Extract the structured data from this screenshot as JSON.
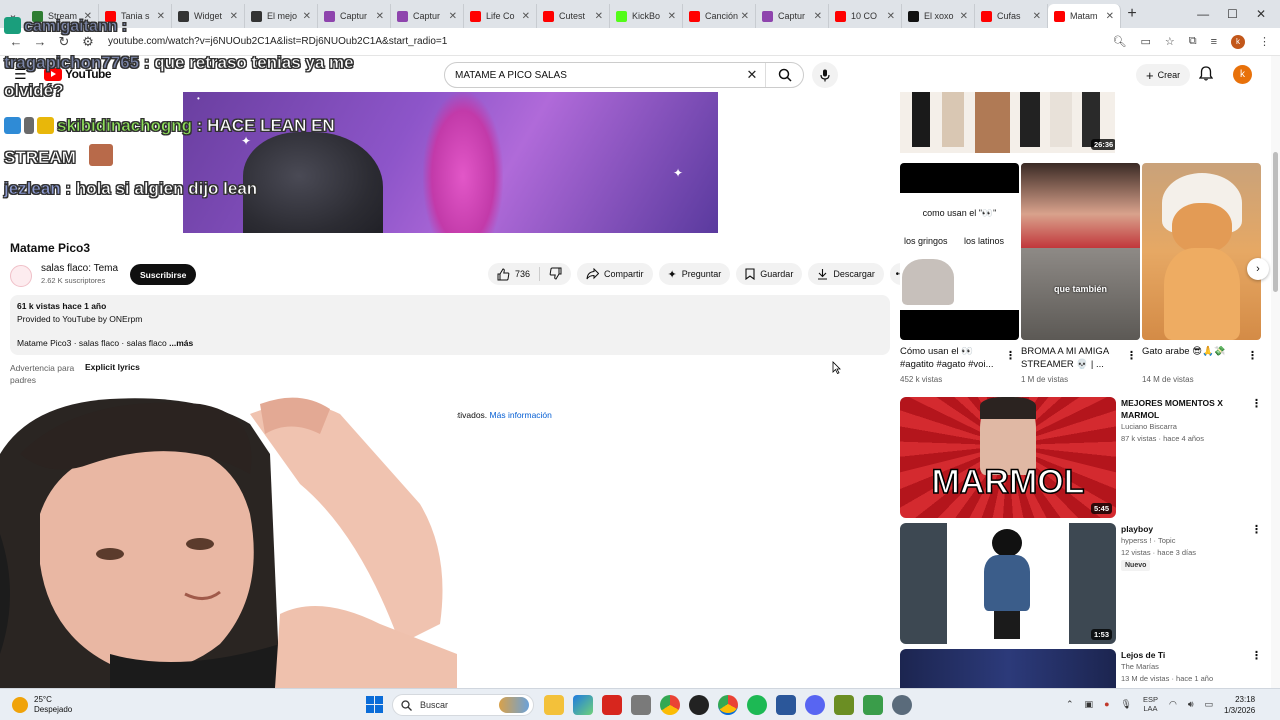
{
  "browser": {
    "tabs": [
      {
        "label": "Stream",
        "color": "#2e7d32"
      },
      {
        "label": "Tania s",
        "color": "#ff0000"
      },
      {
        "label": "Widget",
        "color": "#333333"
      },
      {
        "label": "El mejo",
        "color": "#333333"
      },
      {
        "label": "Captur",
        "color": "#8e44ad"
      },
      {
        "label": "Captur",
        "color": "#8e44ad"
      },
      {
        "label": "Life Co",
        "color": "#ff0000"
      },
      {
        "label": "Cutest",
        "color": "#ff0000"
      },
      {
        "label": "KickBo",
        "color": "#53fc18"
      },
      {
        "label": "Canción",
        "color": "#ff0000"
      },
      {
        "label": "Captur",
        "color": "#8e44ad"
      },
      {
        "label": "10 CO",
        "color": "#ff0000"
      },
      {
        "label": "El xoxo",
        "color": "#111111"
      },
      {
        "label": "Cufas",
        "color": "#ff0000"
      },
      {
        "label": "Matam",
        "color": "#ff0000"
      }
    ],
    "url": "youtube.com/watch?v=j6NUOub2C1A&list=RDj6NUOub2C1A&start_radio=1"
  },
  "youtube": {
    "logo_text": "YouTube",
    "search_value": "MATAME A PICO SALAS",
    "create_label": "Crear",
    "avatar_letter": "k"
  },
  "chat": [
    {
      "user": "tragapichon7765",
      "sep": " : ",
      "msg": "que retraso tenias ya me",
      "msg2": "olvidé?"
    },
    {
      "user": "skibidinachogng",
      "sep": " : ",
      "msg": "HACE LEAN EN",
      "msg2": "STREAM"
    },
    {
      "user": "jezlean",
      "sep": " : ",
      "msg": "hola si algien dijo lean"
    }
  ],
  "chat_top_user": "camigaitann : ",
  "video": {
    "title": "Matame Pico3",
    "channel": "salas flaco: Tema",
    "subscribers": "2.62 K suscriptores",
    "subscribe_label": "Suscribirse",
    "likes": "736",
    "share_label": "Compartir",
    "ask_label": "Preguntar",
    "save_label": "Guardar",
    "download_label": "Descargar",
    "stats": "61 k vistas  hace 1 año",
    "provided": "Provided to YouTube by ONErpm",
    "tags": "Matame Pico3 · salas flaco · salas flaco",
    "more_label": "...más",
    "advisory_label": "Advertencia para padres",
    "advisory_value": "Explicit lyrics",
    "comments_off": "tán desactivados.",
    "comments_link": "Más información"
  },
  "sidebar": {
    "strip_duration": "26:36",
    "shorts": [
      {
        "title": "Cómo usan el 👀 #agatito #agato #voi...",
        "views": "452 k vistas",
        "overlay1": "como usan el \"👀\"",
        "overlay2": "los gringos",
        "overlay3": "los latinos"
      },
      {
        "title": "BROMA A MI AMIGA STREAMER 💀 | ...",
        "views": "1 M de vistas",
        "overlay1": "que también"
      },
      {
        "title": "Gato arabe 😎🙏💸",
        "views": "14 M de vistas"
      }
    ],
    "recs": [
      {
        "title": "MEJORES MOMENTOS X MARMOL",
        "channel": "Luciano Biscarra",
        "meta": "87 k vistas · hace 4 años",
        "duration": "5:45",
        "thumb_text": "MARMOL"
      },
      {
        "title": "playboy",
        "channel": "hyperss ! · Topic",
        "meta": "12 vistas · hace 3 días",
        "duration": "1:53",
        "badge": "Nuevo"
      },
      {
        "title": "Lejos de Ti",
        "channel": "The Marías",
        "meta": "13 M de vistas · hace 1 año"
      }
    ]
  },
  "taskbar": {
    "temperature": "25°C",
    "weather": "Despejado",
    "search_label": "Buscar",
    "lang1": "ESP",
    "lang2": "LAA",
    "time": "23:18",
    "date": "1/3/2026"
  }
}
